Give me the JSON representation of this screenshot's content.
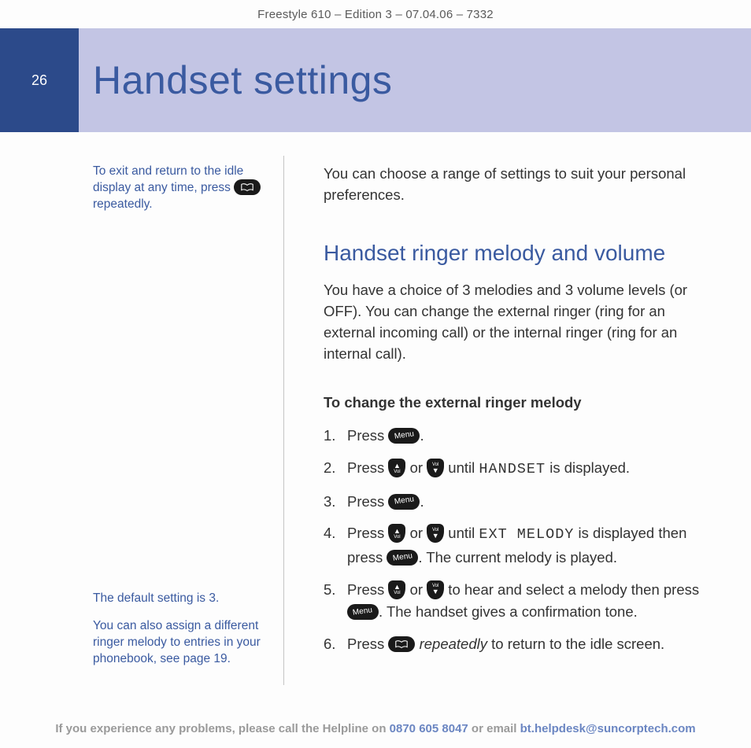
{
  "meta": {
    "header": "Freestyle 610 – Edition 3 – 07.04.06 – 7332"
  },
  "page": {
    "number": "26",
    "title": "Handset settings"
  },
  "sidebar": {
    "note1_a": "To exit and return to the idle display at any time, press ",
    "note1_b": " repeatedly.",
    "note2": "The default setting is 3.",
    "note3": "You can also assign a different ringer melody to entries in your phonebook, see page 19."
  },
  "main": {
    "intro": "You can choose a range of settings to suit your personal preferences.",
    "section": {
      "heading": "Handset ringer melody and volume",
      "body": "You have a choice of 3 melodies and 3 volume levels (or OFF). You can change the external ringer (ring for an external incoming call) or the internal ringer (ring for an internal call).",
      "subheading": "To change the external ringer melody",
      "steps": {
        "s1a": "Press ",
        "s1b": ".",
        "s2a": "Press ",
        "s2b": " or ",
        "s2c": " until ",
        "s2d": "HANDSET",
        "s2e": " is displayed.",
        "s3a": "Press ",
        "s3b": ".",
        "s4a": "Press ",
        "s4b": " or ",
        "s4c": " until ",
        "s4d": "EXT MELODY",
        "s4e": " is displayed then press ",
        "s4f": ". The current melody is played.",
        "s5a": "Press ",
        "s5b": " or ",
        "s5c": " to hear and select a melody then press ",
        "s5d": ". The handset gives a confirmation tone.",
        "s6a": "Press ",
        "s6b": " ",
        "s6c": "repeatedly",
        "s6d": " to return to the idle screen."
      }
    }
  },
  "buttons": {
    "menu": "Menu",
    "up_label": "Vol",
    "down_label": "Vol"
  },
  "footer": {
    "a": "If you experience any problems, please call the Helpline on ",
    "phone": "0870 605 8047",
    "b": " or email ",
    "email": "bt.helpdesk@suncorptech.com"
  }
}
